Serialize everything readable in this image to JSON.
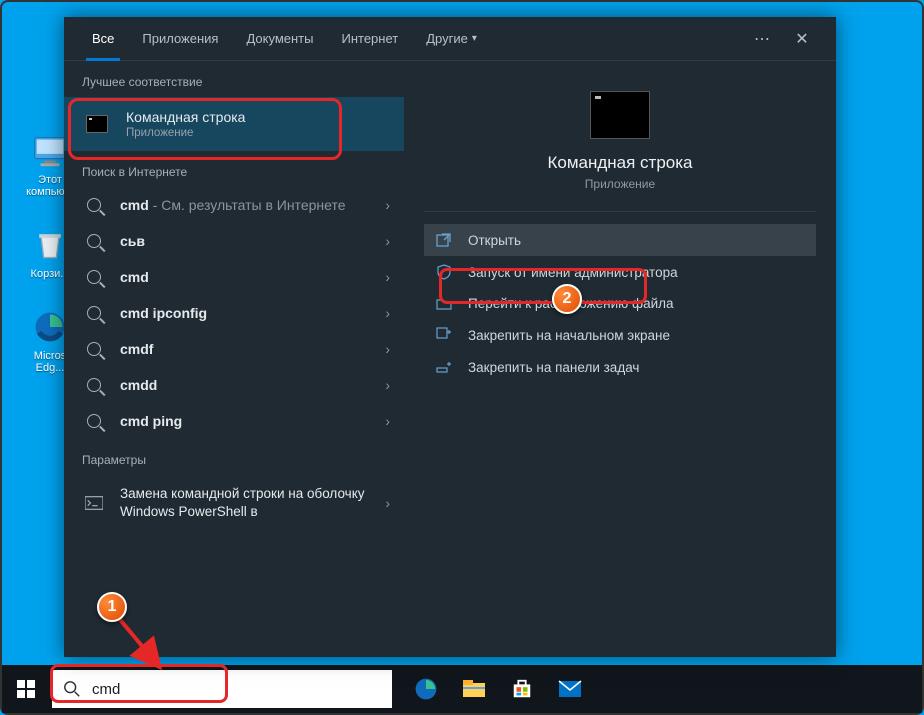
{
  "desktop": {
    "icons": [
      {
        "label": "Этот компью..."
      },
      {
        "label": "Корзи..."
      },
      {
        "label": "Micros Edg..."
      }
    ]
  },
  "tabs": {
    "all": "Все",
    "apps": "Приложения",
    "docs": "Документы",
    "web": "Интернет",
    "more": "Другие"
  },
  "sections": {
    "best_match": "Лучшее соответствие",
    "web_search": "Поиск в Интернете",
    "settings": "Параметры"
  },
  "best": {
    "title": "Командная строка",
    "subtitle": "Приложение"
  },
  "web_results": [
    {
      "bold": "cmd",
      "rest": " - См. результаты в Интернете"
    },
    {
      "bold": "сьв",
      "rest": ""
    },
    {
      "bold": "cmd",
      "rest": ""
    },
    {
      "bold": "cmd ipconfig",
      "rest": ""
    },
    {
      "bold": "cmdf",
      "rest": ""
    },
    {
      "bold": "cmdd",
      "rest": ""
    },
    {
      "bold": "cmd ping",
      "rest": ""
    }
  ],
  "settings_result": {
    "text": "Замена командной строки на оболочку Windows PowerShell в"
  },
  "preview": {
    "title": "Командная строка",
    "subtitle": "Приложение"
  },
  "actions": {
    "open": "Открыть",
    "run_admin": "Запуск от имени администратора",
    "open_location": "Перейти к расположению файла",
    "pin_start": "Закрепить на начальном экране",
    "pin_taskbar": "Закрепить на панели задач"
  },
  "search": {
    "value": "cmd"
  },
  "badges": {
    "one": "1",
    "two": "2"
  }
}
